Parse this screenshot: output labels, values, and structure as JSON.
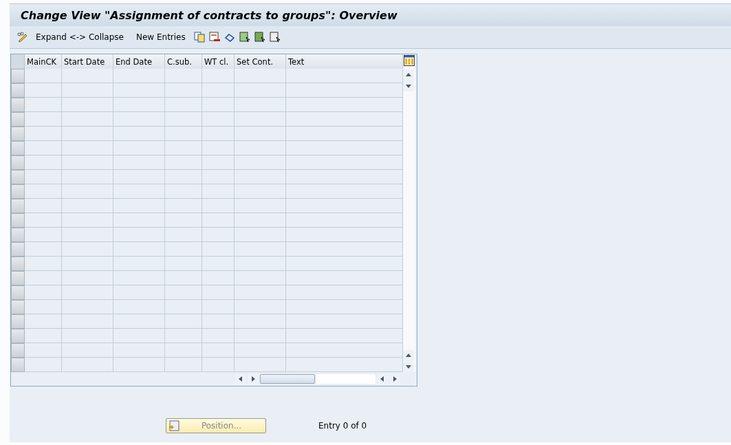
{
  "window": {
    "title": "Change View \"Assignment of contracts to groups\": Overview"
  },
  "toolbar": {
    "items": [
      {
        "kind": "icon"
      },
      {
        "kind": "text",
        "label": "Expand <-> Collapse"
      },
      {
        "kind": "text",
        "label": "New Entries"
      },
      {
        "kind": "icon"
      },
      {
        "kind": "icon"
      },
      {
        "kind": "icon"
      },
      {
        "kind": "icon"
      },
      {
        "kind": "icon"
      },
      {
        "kind": "icon"
      }
    ]
  },
  "table": {
    "columns": [
      "MainCK",
      "Start Date",
      "End Date",
      "C.sub.",
      "WT cl.",
      "Set Cont.",
      "Text"
    ],
    "rows": [
      {
        "selected": false
      },
      {
        "selected": false
      },
      {
        "selected": false
      },
      {
        "selected": false
      },
      {
        "selected": false
      },
      {
        "selected": false
      },
      {
        "selected": false
      },
      {
        "selected": false
      },
      {
        "selected": false
      },
      {
        "selected": false
      },
      {
        "selected": false
      },
      {
        "selected": false
      },
      {
        "selected": false
      },
      {
        "selected": false
      },
      {
        "selected": false
      },
      {
        "selected": false
      },
      {
        "selected": false
      },
      {
        "selected": false
      },
      {
        "selected": false
      },
      {
        "selected": false
      },
      {
        "selected": false
      }
    ]
  },
  "position_button": {
    "label": "Position...",
    "disabled": true
  },
  "entry_count": "Entry 0 of 0"
}
